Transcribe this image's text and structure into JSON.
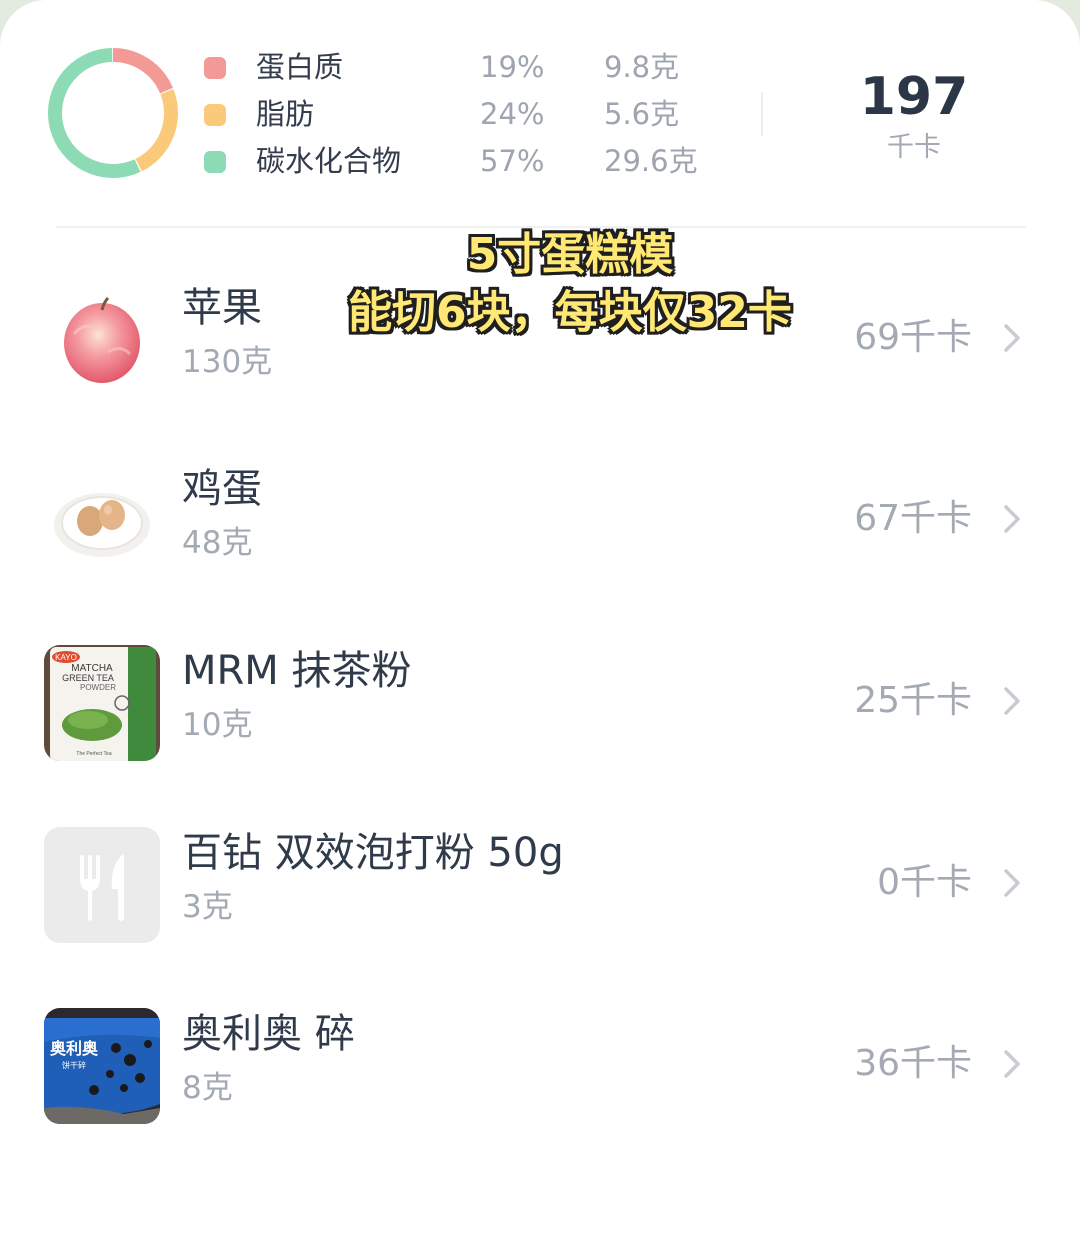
{
  "summary": {
    "macros": [
      {
        "name": "蛋白质",
        "percent": "19%",
        "amount": "9.8克",
        "color": "#f49a96",
        "ratio": 0.19
      },
      {
        "name": "脂肪",
        "percent": "24%",
        "amount": "5.6克",
        "color": "#fbc97a",
        "ratio": 0.24
      },
      {
        "name": "碳水化合物",
        "percent": "57%",
        "amount": "29.6克",
        "color": "#8ddbb5",
        "ratio": 0.57
      }
    ],
    "total_kcal": "197",
    "total_unit": "千卡"
  },
  "overlay": {
    "line1": "5寸蛋糕模",
    "line2": "能切6块，每块仅32卡"
  },
  "foods": [
    {
      "name": "苹果",
      "weight": "130克",
      "kcal": "69千卡",
      "icon": "apple-icon"
    },
    {
      "name": "鸡蛋",
      "weight": "48克",
      "kcal": "67千卡",
      "icon": "egg-icon"
    },
    {
      "name": "MRM 抹茶粉",
      "weight": "10克",
      "kcal": "25千卡",
      "icon": "matcha-package-icon"
    },
    {
      "name": "百钻 双效泡打粉 50g",
      "weight": "3克",
      "kcal": "0千卡",
      "icon": "fork-knife-icon"
    },
    {
      "name": "奥利奥 碎",
      "weight": "8克",
      "kcal": "36千卡",
      "icon": "oreo-package-icon"
    }
  ],
  "thumb_text": {
    "matcha_brand": "KAYO",
    "matcha_line1": "MATCHA",
    "matcha_line2": "GREEN TEA",
    "matcha_line3": "POWDER",
    "matcha_tag": "The Perfect Tea",
    "oreo_brand": "奥利奥",
    "oreo_sub": "饼干碎"
  }
}
